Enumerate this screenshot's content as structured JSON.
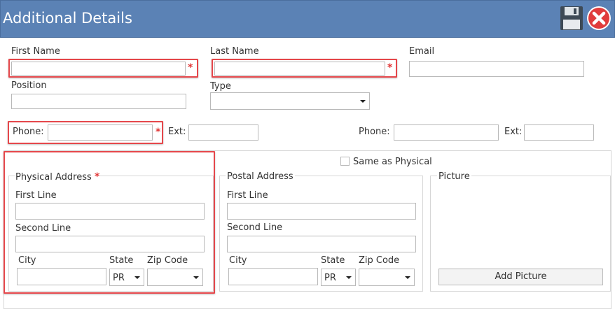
{
  "window": {
    "title": "Additional Details"
  },
  "toolbar": {
    "save_icon": "floppy-disk-icon",
    "close_icon": "close-icon"
  },
  "fields": {
    "first_name": {
      "label": "First Name",
      "value": "",
      "required_mark": "*"
    },
    "last_name": {
      "label": "Last Name",
      "value": "",
      "required_mark": "*"
    },
    "email": {
      "label": "Email",
      "value": ""
    },
    "position": {
      "label": "Position",
      "value": ""
    },
    "type": {
      "label": "Type",
      "value": ""
    },
    "phone": {
      "label": "Phone:",
      "value": "",
      "required_mark": "*"
    },
    "ext": {
      "label": "Ext:",
      "value": ""
    },
    "phone2": {
      "label": "Phone:",
      "value": ""
    },
    "ext2": {
      "label": "Ext:",
      "value": ""
    }
  },
  "same_as_physical": {
    "label": "Same as Physical",
    "checked": false
  },
  "physical_address": {
    "title": "Physical Address",
    "required_mark": "*",
    "first_line_label": "First Line",
    "second_line_label": "Second Line",
    "city_label": "City",
    "state_label": "State",
    "state_value": "PR",
    "zip_label": "Zip Code"
  },
  "postal_address": {
    "title": "Postal Address",
    "first_line_label": "First Line",
    "second_line_label": "Second Line",
    "city_label": "City",
    "state_label": "State",
    "state_value": "PR",
    "zip_label": "Zip Code"
  },
  "picture": {
    "title": "Picture",
    "add_button": "Add Picture"
  },
  "colors": {
    "titlebar": "#5b82b5",
    "required_highlight": "#e5474b",
    "close_red": "#e03c3c"
  }
}
